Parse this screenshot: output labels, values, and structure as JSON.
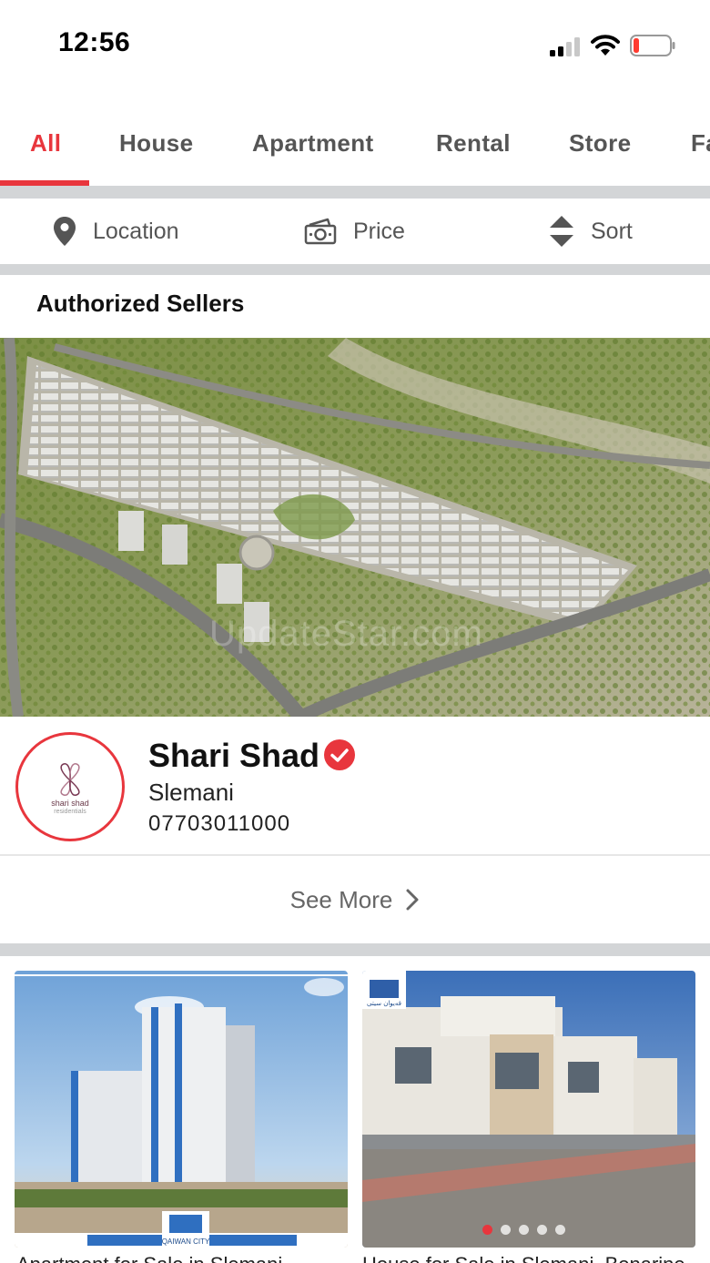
{
  "status_bar": {
    "time": "12:56",
    "signal_bars": 2,
    "battery_level": 0.1
  },
  "tabs": [
    {
      "label": "All",
      "active": true
    },
    {
      "label": "House",
      "active": false
    },
    {
      "label": "Apartment",
      "active": false
    },
    {
      "label": "Rental",
      "active": false
    },
    {
      "label": "Store",
      "active": false
    },
    {
      "label": "Fa",
      "active": false
    }
  ],
  "filters": {
    "location": {
      "label": "Location",
      "icon": "map-pin-icon"
    },
    "price": {
      "label": "Price",
      "icon": "money-icon"
    },
    "sort": {
      "label": "Sort",
      "icon": "sort-icon"
    }
  },
  "authorized_sellers": {
    "title": "Authorized Sellers",
    "watermark": "UpdateStar.com",
    "seller": {
      "name": "Shari Shad",
      "city": "Slemani",
      "phone": "07703011000",
      "logo_text": "shari shad",
      "logo_subtext": "residentials",
      "verified": true
    },
    "see_more_label": "See More"
  },
  "listings": [
    {
      "title": "Apartment for Sale in Slemani",
      "logo_text": "QAIWAN CITY"
    },
    {
      "title": "House for Sale in Slemani, Bonarine",
      "logo_text": "قەیوان سیتی"
    }
  ],
  "colors": {
    "accent": "#e8363d",
    "separator": "#d3d5d7"
  }
}
